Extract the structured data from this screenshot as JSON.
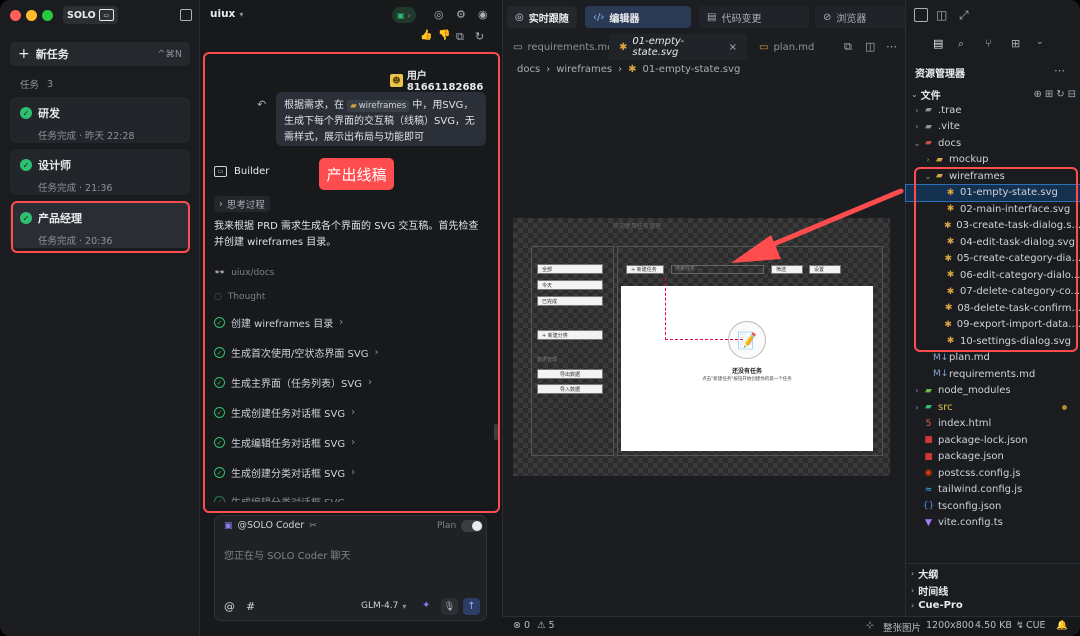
{
  "sidebar": {
    "brand": "SOLO",
    "new_task": "新任务",
    "new_task_shortcut": "^⌘N",
    "tasks_label": "任务",
    "tasks_count": "3",
    "tasks": [
      {
        "title": "研发",
        "status": "任务完成 · 昨天 22:28"
      },
      {
        "title": "设计师",
        "status": "任务完成 · 21:36"
      },
      {
        "title": "产品经理",
        "status": "任务完成 · 20:36"
      }
    ]
  },
  "chat": {
    "workspace": "uiux",
    "user_name": "用户81661182686",
    "user_message_pre": "根据需求，在",
    "user_message_folder": "wireframes",
    "user_message_post": "中，用SVG，生成下每个界面的交互稿（线稿）SVG，无需样式，展示出布局与功能即可",
    "builder_label": "Builder",
    "annotation": "产出线稿",
    "thinking_label": "思考过程",
    "reply": "我来根据 PRD 需求生成各个界面的 SVG 交互稿。首先检查并创建 wireframes 目录。",
    "path": "uiux/docs",
    "thought_label": "Thought",
    "steps": [
      "创建 wireframes 目录",
      "生成首次使用/空状态界面 SVG",
      "生成主界面（任务列表）SVG",
      "生成创建任务对话框 SVG",
      "生成编辑任务对话框 SVG",
      "生成创建分类对话框 SVG",
      "生成编辑分类对话框 SVG"
    ],
    "composer_agent": "@SOLO Coder",
    "composer_mode": "Plan",
    "composer_placeholder": "您正在与 SOLO Coder 聊天",
    "model": "GLM-4.7"
  },
  "editor": {
    "top_tabs": [
      "实时跟随",
      "编辑器",
      "代码变更",
      "浏览器"
    ],
    "file_tabs": [
      "requirements.md",
      "01-empty-state.svg",
      "plan.md"
    ],
    "breadcrumb": [
      "docs",
      "wireframes",
      "01-empty-state.svg"
    ],
    "preview": {
      "title": "欢迎使用任务管理",
      "side_items": [
        "全部",
        "今天",
        "已完成"
      ],
      "new_category": "+ 新建分类",
      "data_label": "数据管理",
      "export": "导出数据",
      "import": "导入数据",
      "new_task": "+ 新建任务",
      "search": "搜索任务...",
      "filter": "筛选",
      "settings": "设置",
      "empty_title": "还没有任务",
      "empty_desc": "点击\"新建任务\"按钮开始创建你的第一个任务"
    }
  },
  "explorer": {
    "title": "资源管理器",
    "files_label": "文件",
    "tree": [
      {
        "name": ".trae",
        "kind": "folder",
        "depth": 0,
        "open": false
      },
      {
        "name": ".vite",
        "kind": "folder",
        "depth": 0,
        "open": false
      },
      {
        "name": "docs",
        "kind": "folder",
        "depth": 0,
        "open": true
      },
      {
        "name": "mockup",
        "kind": "folder",
        "depth": 1,
        "open": false
      },
      {
        "name": "wireframes",
        "kind": "folder",
        "depth": 1,
        "open": true
      },
      {
        "name": "01-empty-state.svg",
        "kind": "svg",
        "depth": 2,
        "selected": true
      },
      {
        "name": "02-main-interface.svg",
        "kind": "svg",
        "depth": 2
      },
      {
        "name": "03-create-task-dialog.s...",
        "kind": "svg",
        "depth": 2
      },
      {
        "name": "04-edit-task-dialog.svg",
        "kind": "svg",
        "depth": 2
      },
      {
        "name": "05-create-category-dia...",
        "kind": "svg",
        "depth": 2
      },
      {
        "name": "06-edit-category-dialo...",
        "kind": "svg",
        "depth": 2
      },
      {
        "name": "07-delete-category-co...",
        "kind": "svg",
        "depth": 2
      },
      {
        "name": "08-delete-task-confirm...",
        "kind": "svg",
        "depth": 2
      },
      {
        "name": "09-export-import-data....",
        "kind": "svg",
        "depth": 2
      },
      {
        "name": "10-settings-dialog.svg",
        "kind": "svg",
        "depth": 2
      },
      {
        "name": "plan.md",
        "kind": "md",
        "depth": 1
      },
      {
        "name": "requirements.md",
        "kind": "md",
        "depth": 1
      },
      {
        "name": "node_modules",
        "kind": "folder",
        "depth": 0,
        "open": false
      },
      {
        "name": "src",
        "kind": "folder",
        "depth": 0,
        "open": false,
        "modified": true
      },
      {
        "name": "index.html",
        "kind": "html",
        "depth": 0
      },
      {
        "name": "package-lock.json",
        "kind": "npm",
        "depth": 0
      },
      {
        "name": "package.json",
        "kind": "npm",
        "depth": 0
      },
      {
        "name": "postcss.config.js",
        "kind": "postcss",
        "depth": 0
      },
      {
        "name": "tailwind.config.js",
        "kind": "tailwind",
        "depth": 0
      },
      {
        "name": "tsconfig.json",
        "kind": "ts",
        "depth": 0
      },
      {
        "name": "vite.config.ts",
        "kind": "vite",
        "depth": 0
      }
    ],
    "sections": [
      "大纲",
      "时间线",
      "Cue-Pro"
    ]
  },
  "status": {
    "errors": "0",
    "warnings": "5",
    "view_label": "整张图片",
    "dimensions": "1200x800",
    "size": "4.50 KB",
    "cue": "CUE"
  },
  "colors": {
    "accent": "#2fbf71",
    "annotation": "#ff4d4f",
    "primary": "#3d7ef5"
  }
}
